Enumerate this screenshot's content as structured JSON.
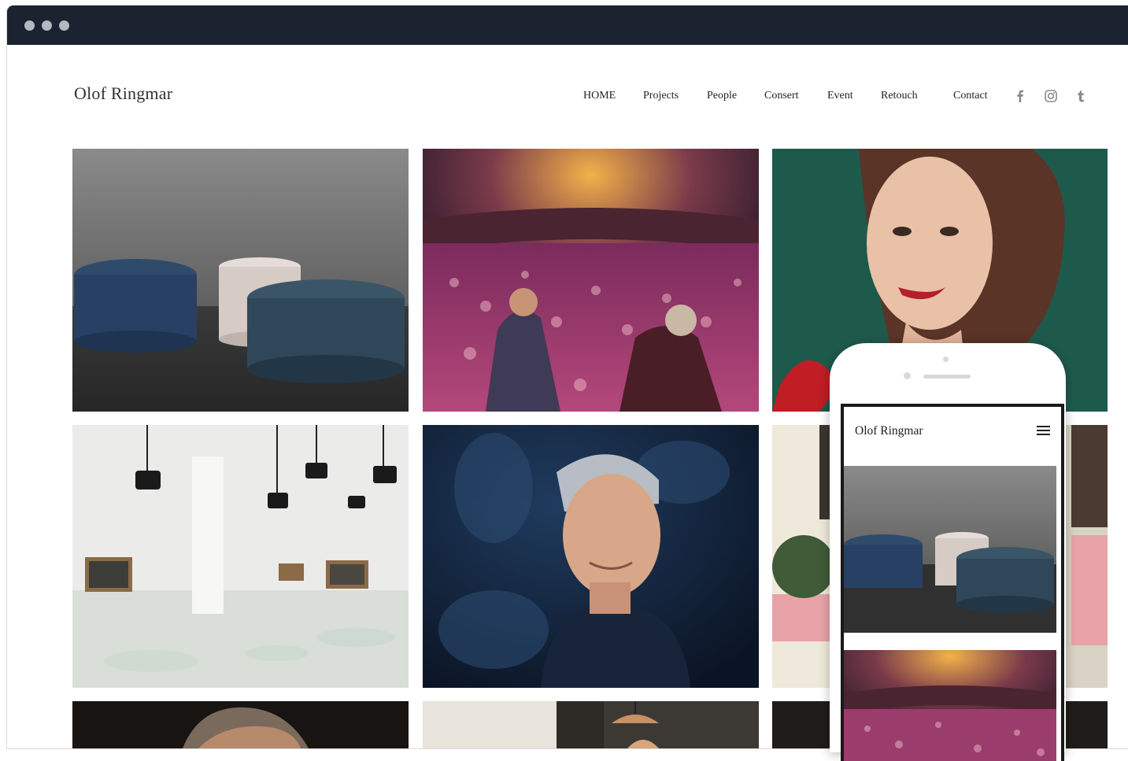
{
  "site": {
    "title": "Olof Ringmar",
    "nav": [
      "HOME",
      "Projects",
      "People",
      "Consert",
      "Event",
      "Retouch",
      "Contact"
    ]
  },
  "social": [
    "facebook-icon",
    "instagram-icon",
    "tumblr-icon"
  ],
  "gallery": [
    "furniture-poufs-photo",
    "concert-crowd-photo",
    "woman-red-lips-portrait",
    "white-gallery-installation-photo",
    "grey-haired-man-portrait",
    "street-storefront-photo",
    "man-portrait-photo",
    "pendant-lamps-bar-photo",
    "dark-interior-photo"
  ],
  "mobile": {
    "title": "Olof Ringmar",
    "menu_icon": "hamburger-menu-icon"
  },
  "colors": {
    "titlebar": "#1b2230",
    "text": "#222222",
    "social_icons": "#8a8a8a"
  }
}
